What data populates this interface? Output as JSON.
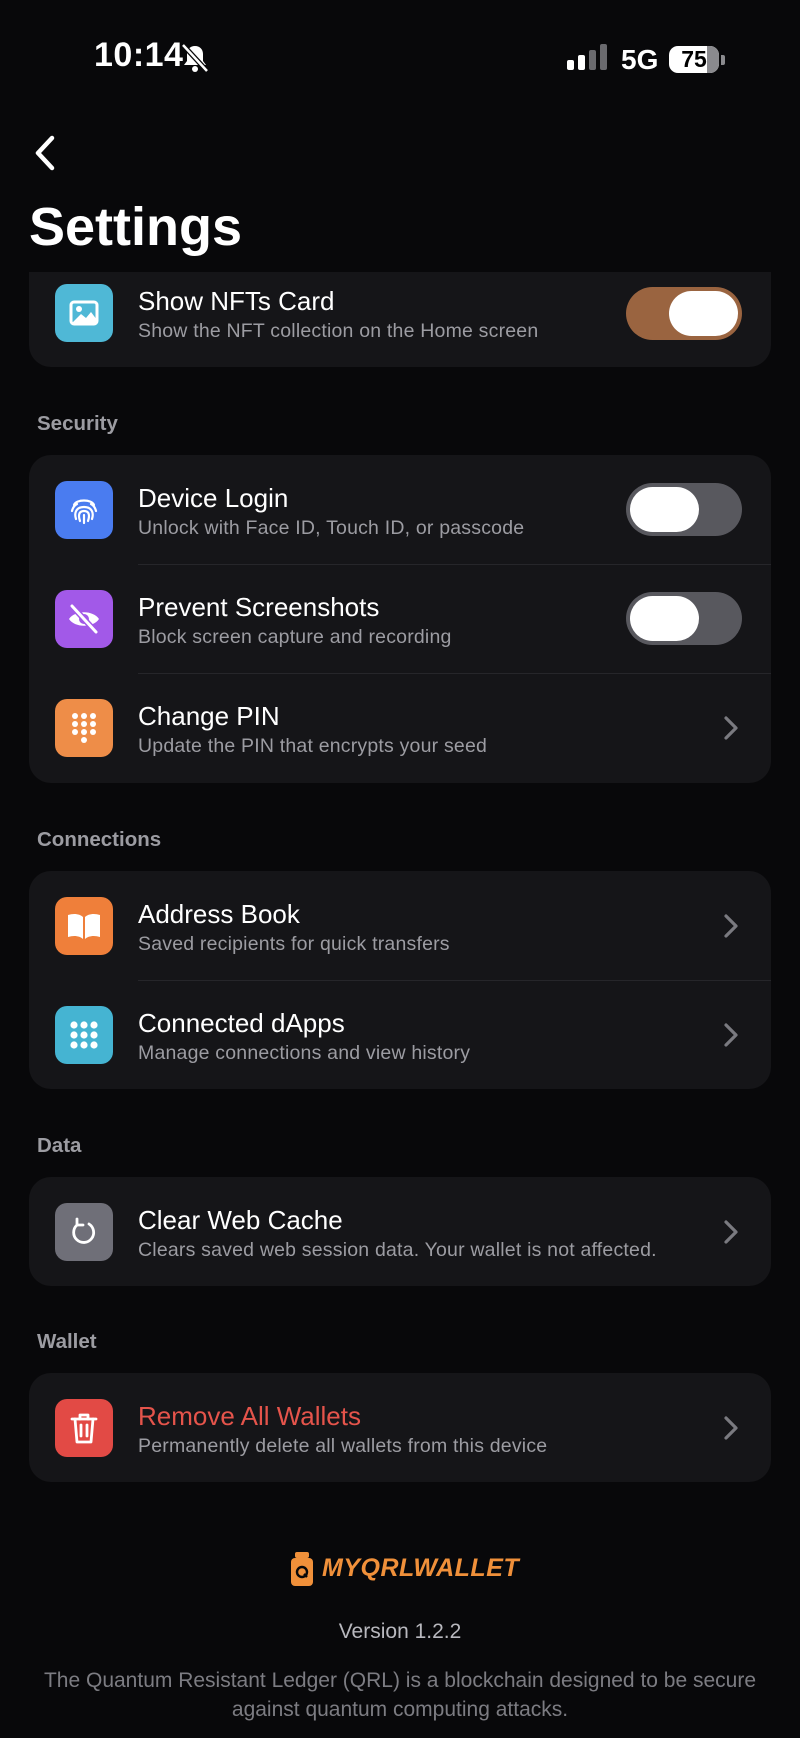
{
  "status_bar": {
    "time": "10:14",
    "network": "5G",
    "battery": "75"
  },
  "header": {
    "title": "Settings"
  },
  "sections": {
    "display": {
      "items": [
        {
          "title": "Show NFTs Card",
          "subtitle": "Show the NFT collection on the Home screen",
          "toggle": "on",
          "icon": "image-icon",
          "color": "#4fb8d6"
        }
      ]
    },
    "security": {
      "label": "Security",
      "items": [
        {
          "title": "Device Login",
          "subtitle": "Unlock with Face ID, Touch ID, or passcode",
          "toggle": "off",
          "icon": "fingerprint-icon",
          "color": "#4a7cf0"
        },
        {
          "title": "Prevent Screenshots",
          "subtitle": "Block screen capture and recording",
          "toggle": "off",
          "icon": "eye-slash-icon",
          "color": "#a259e8"
        },
        {
          "title": "Change PIN",
          "subtitle": "Update the PIN that encrypts your seed",
          "icon": "keypad-icon",
          "color": "#ee8d48"
        }
      ]
    },
    "connections": {
      "label": "Connections",
      "items": [
        {
          "title": "Address Book",
          "subtitle": "Saved recipients for quick transfers",
          "icon": "book-icon",
          "color": "#ef7f3a"
        },
        {
          "title": "Connected dApps",
          "subtitle": "Manage connections and view history",
          "icon": "grid-icon",
          "color": "#45b4d2"
        }
      ]
    },
    "data": {
      "label": "Data",
      "items": [
        {
          "title": "Clear Web Cache",
          "subtitle": "Clears saved web session data. Your wallet is not affected.",
          "icon": "refresh-icon",
          "color": "#6f6f78"
        }
      ]
    },
    "wallet": {
      "label": "Wallet",
      "items": [
        {
          "title": "Remove All Wallets",
          "subtitle": "Permanently delete all wallets from this device",
          "icon": "trash-icon",
          "color": "#e24a45",
          "title_color": "#e5544b"
        }
      ]
    }
  },
  "footer": {
    "brand": "MYQRLWALLET",
    "version": "Version 1.2.2",
    "description": "The Quantum Resistant Ledger (QRL) is a blockchain designed to be secure against quantum computing attacks."
  },
  "colors": {
    "background": "#08080a",
    "card": "#151518",
    "accent": "#f0903a",
    "toggle_on": "#9a6440",
    "toggle_off": "#58585e"
  }
}
